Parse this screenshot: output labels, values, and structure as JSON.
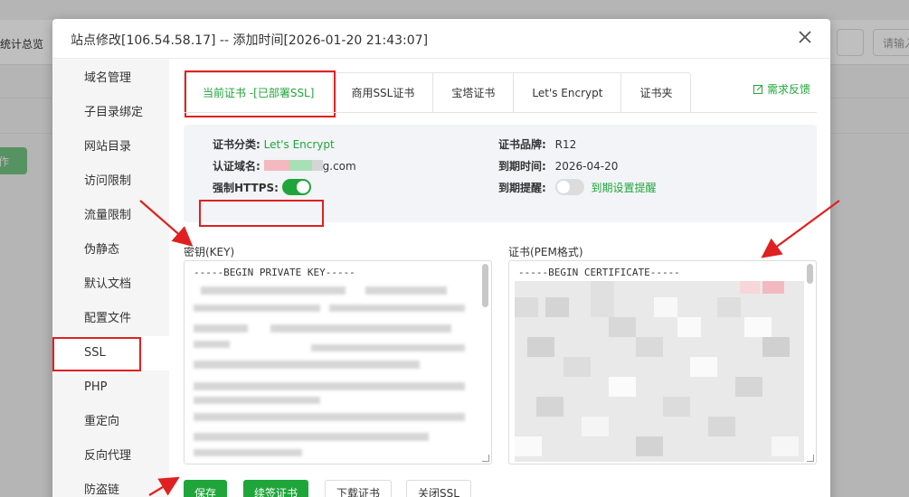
{
  "background": {
    "stats_label": "统计总览",
    "search_placeholder": "请输入"
  },
  "modal": {
    "title": "站点修改[106.54.58.17] -- 添加时间[2026-01-20 21:43:07]",
    "close_icon": "close-icon"
  },
  "sidebar": {
    "items": [
      {
        "label": "域名管理"
      },
      {
        "label": "子目录绑定"
      },
      {
        "label": "网站目录"
      },
      {
        "label": "访问限制"
      },
      {
        "label": "流量限制"
      },
      {
        "label": "伪静态"
      },
      {
        "label": "默认文档"
      },
      {
        "label": "配置文件"
      },
      {
        "label": "SSL"
      },
      {
        "label": "PHP"
      },
      {
        "label": "重定向"
      },
      {
        "label": "反向代理"
      },
      {
        "label": "防盗链"
      }
    ],
    "active": "SSL"
  },
  "tabs": [
    {
      "label": "当前证书 -[已部署SSL]"
    },
    {
      "label": "商用SSL证书"
    },
    {
      "label": "宝塔证书"
    },
    {
      "label": "Let's Encrypt"
    },
    {
      "label": "证书夹"
    }
  ],
  "feedback_label": "需求反馈",
  "cert_info": {
    "category_label": "证书分类:",
    "category_value": "Let's Encrypt",
    "domain_label": "认证域名:",
    "domain_suffix": "g.com",
    "force_https_label": "强制HTTPS:",
    "force_https_on": true,
    "brand_label": "证书品牌:",
    "brand_value": "R12",
    "expire_label": "到期时间:",
    "expire_value": "2026-04-20",
    "remind_label": "到期提醒:",
    "remind_on": false,
    "remind_link": "到期设置提醒"
  },
  "key_field": {
    "label": "密钥(KEY)",
    "first_line": "-----BEGIN PRIVATE KEY-----"
  },
  "cert_field": {
    "label": "证书(PEM格式)",
    "first_line": "-----BEGIN CERTIFICATE-----"
  },
  "buttons": {
    "save": "保存",
    "renew": "续签证书",
    "download": "下载证书",
    "close_ssl": "关闭SSL"
  },
  "colors": {
    "accent": "#20a53a",
    "highlight": "#e02020"
  }
}
